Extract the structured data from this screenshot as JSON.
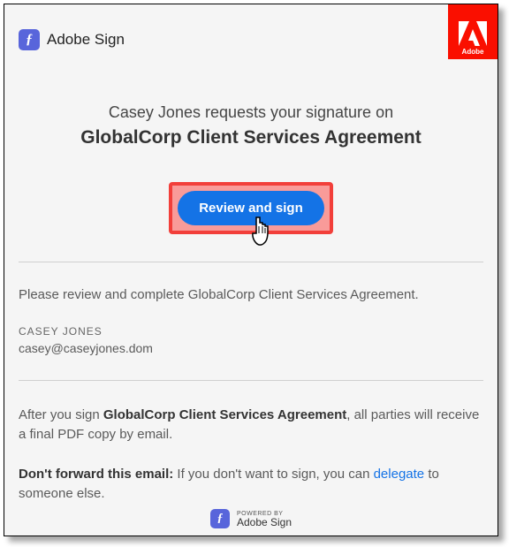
{
  "brand": {
    "name": "Adobe Sign",
    "icon_glyph": "ƒ"
  },
  "adobe_logo": {
    "word": "Adobe"
  },
  "hero": {
    "request_line": "Casey Jones requests your signature on",
    "doc_title": "GlobalCorp Client Services Agreement"
  },
  "cta": {
    "label": "Review and sign"
  },
  "instruction": "Please review and complete GlobalCorp Client Services Agreement.",
  "sender": {
    "name": "CASEY JONES",
    "email": "casey@caseyjones.dom"
  },
  "after_sign": {
    "prefix": "After you sign ",
    "doc": "GlobalCorp Client Services Agreement",
    "suffix": ", all parties will receive a final PDF copy by email."
  },
  "dont_forward": {
    "label": "Don't forward this email:",
    "text_before": " If you don't want to sign, you can ",
    "link": "delegate",
    "text_after": " to someone else."
  },
  "powered": {
    "top": "POWERED BY",
    "bottom": "Adobe Sign",
    "icon_glyph": "ƒ"
  }
}
